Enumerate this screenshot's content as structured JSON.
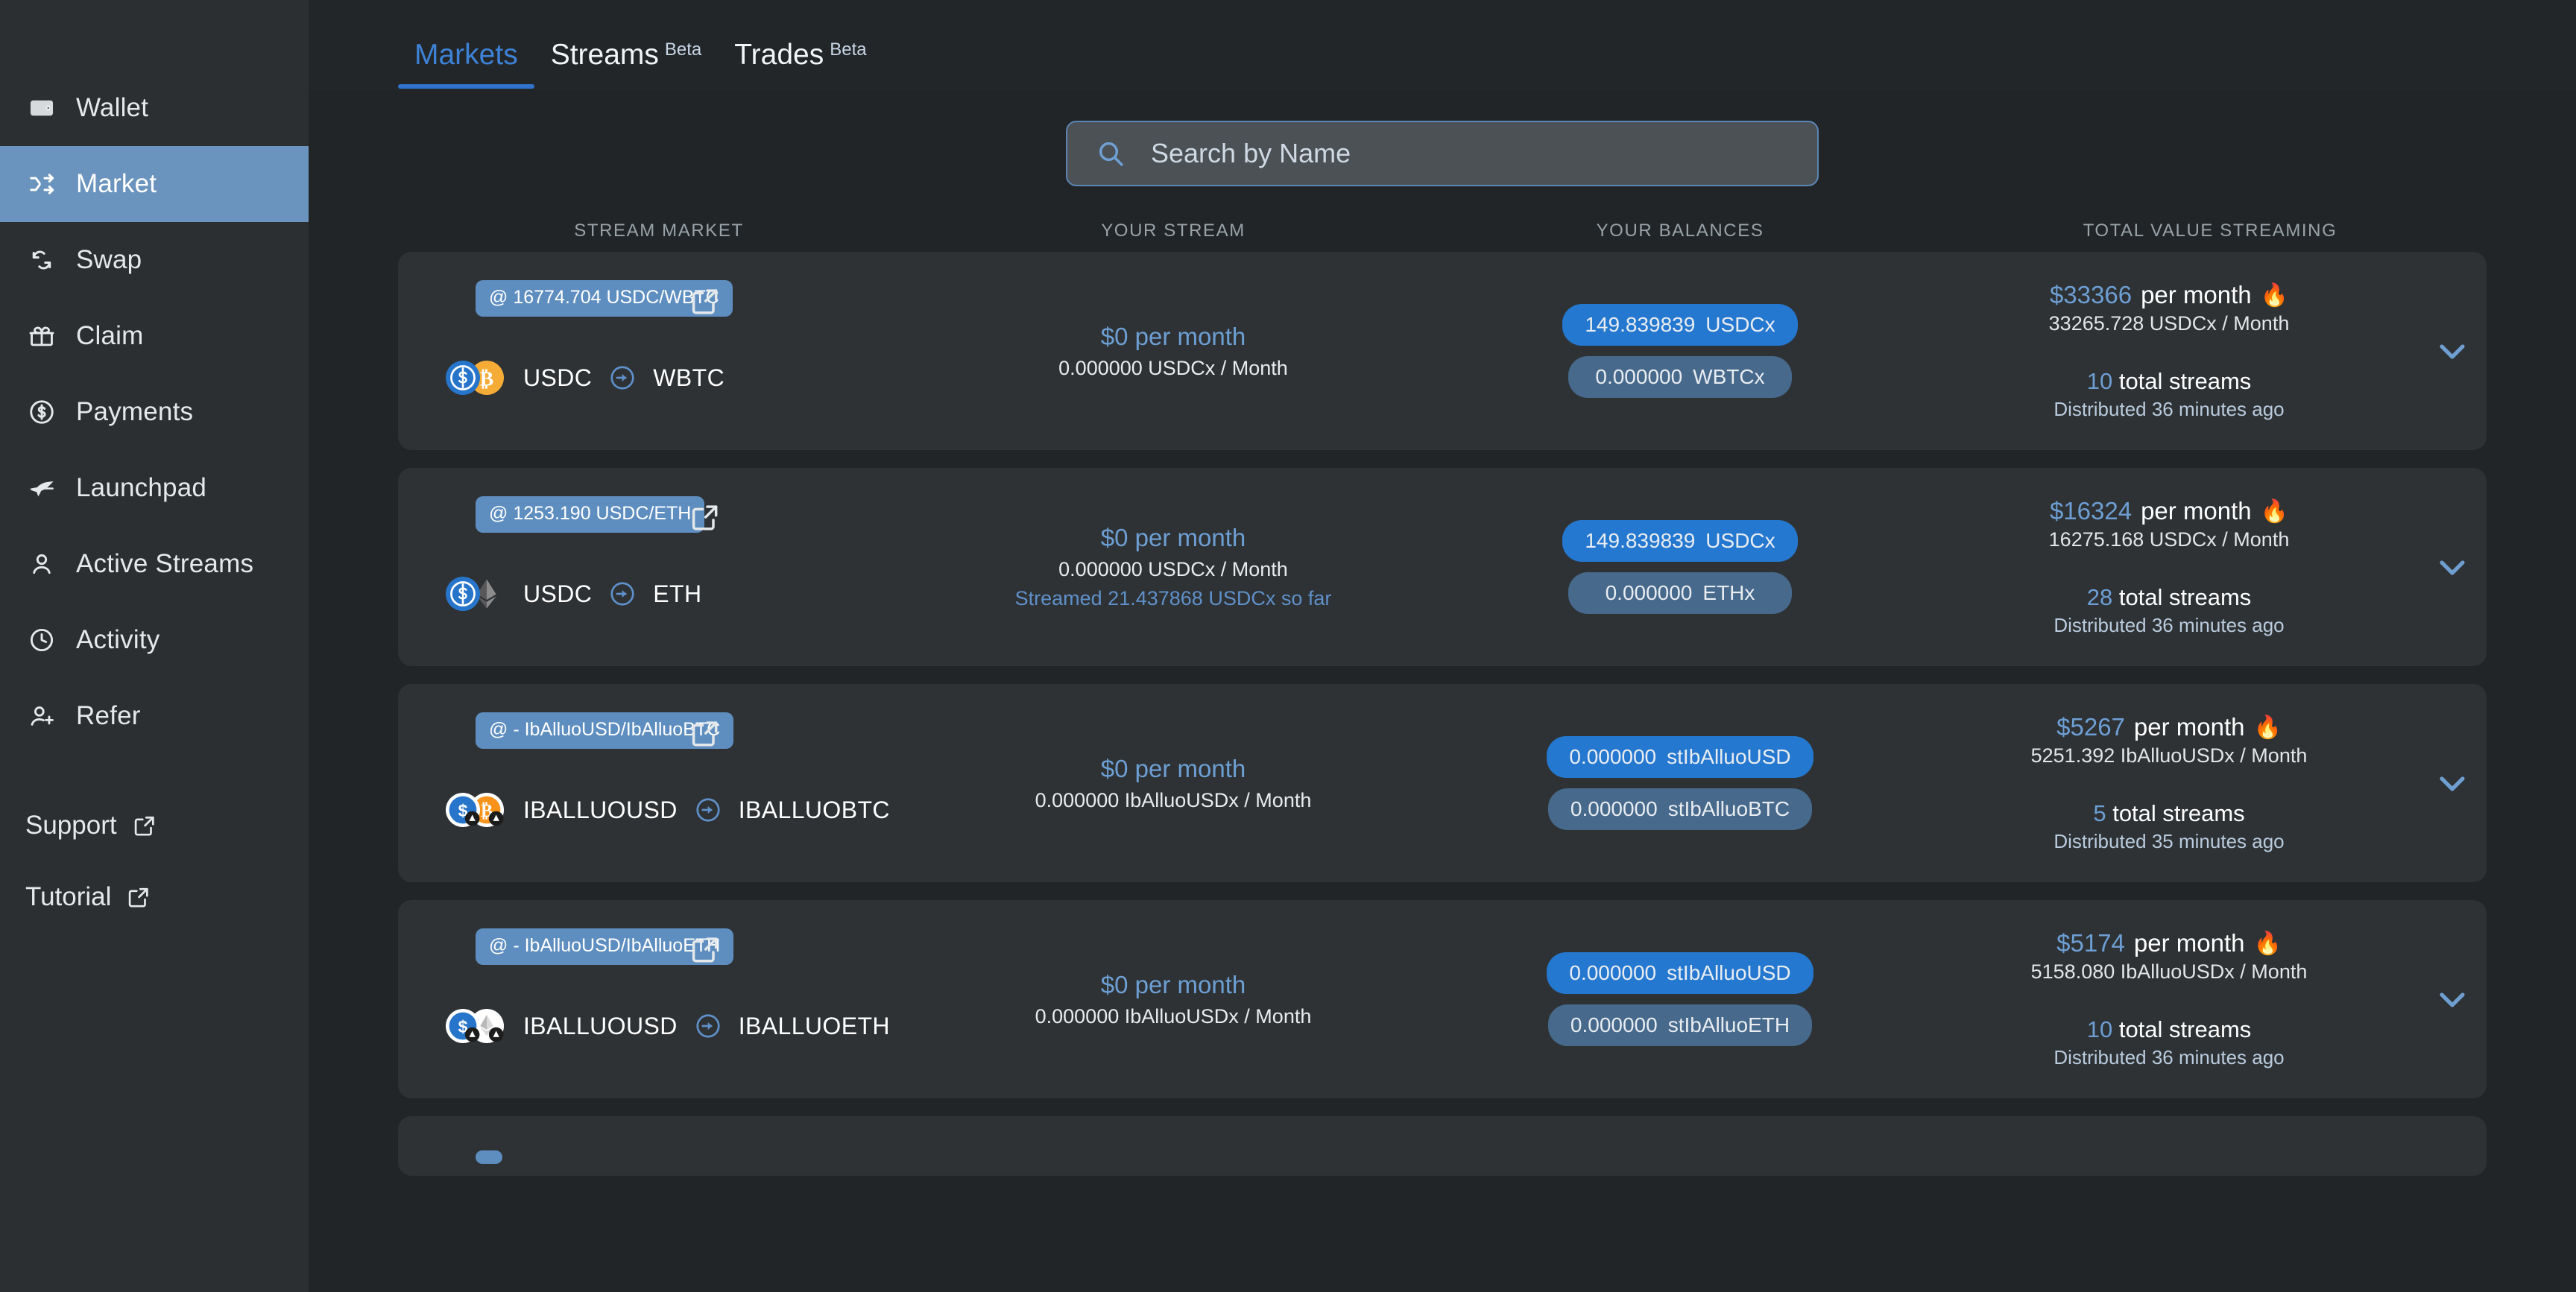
{
  "sidebar": {
    "items": [
      {
        "label": "Wallet",
        "icon": "wallet-icon",
        "active": false
      },
      {
        "label": "Market",
        "icon": "shuffle-icon",
        "active": true
      },
      {
        "label": "Swap",
        "icon": "swap-icon",
        "active": false
      },
      {
        "label": "Claim",
        "icon": "gift-icon",
        "active": false
      },
      {
        "label": "Payments",
        "icon": "dollar-circle-icon",
        "active": false
      },
      {
        "label": "Launchpad",
        "icon": "rocket-icon",
        "active": false
      },
      {
        "label": "Active Streams",
        "icon": "user-icon",
        "active": false
      },
      {
        "label": "Activity",
        "icon": "clock-icon",
        "active": false
      },
      {
        "label": "Refer",
        "icon": "user-plus-icon",
        "active": false
      }
    ],
    "links": [
      {
        "label": "Support",
        "icon": "external-link-icon"
      },
      {
        "label": "Tutorial",
        "icon": "external-link-icon"
      }
    ]
  },
  "tabs": [
    {
      "label": "Markets",
      "badge": "",
      "active": true
    },
    {
      "label": "Streams",
      "badge": "Beta",
      "active": false
    },
    {
      "label": "Trades",
      "badge": "Beta",
      "active": false
    }
  ],
  "search": {
    "placeholder": "Search by Name",
    "value": "",
    "icon": "search-icon"
  },
  "columns": [
    "STREAM MARKET",
    "YOUR STREAM",
    "YOUR BALANCES",
    "TOTAL VALUE STREAMING"
  ],
  "colors": {
    "accent_blue": "#3d82d6",
    "pill_strong": "#2578d0",
    "pill_muted": "#46698c",
    "badge_blue": "#5e8ec0",
    "sidebar_active": "#6a93bd",
    "card_bg": "#2e3235",
    "page_bg": "#212528"
  },
  "rows": [
    {
      "rate": "@ 16774.704 USDC/WBTC",
      "from_token": "USDC",
      "to_token": "WBTC",
      "from_coin": "usdc",
      "to_coin": "wbtc",
      "stream_value": "$0 per month",
      "stream_rate": "0.000000 USDCx / Month",
      "streamed_so_far": "",
      "balances": [
        {
          "amount": "149.839839",
          "symbol": "USDCx",
          "strong": true
        },
        {
          "amount": "0.000000",
          "symbol": "WBTCx",
          "strong": false
        }
      ],
      "total_value": "$33366",
      "total_value_suffix": "per month",
      "flame": "🔥",
      "total_rate": "33265.728 USDCx / Month",
      "stream_count": "10",
      "stream_count_label": "total streams",
      "distributed": "Distributed 36 minutes ago"
    },
    {
      "rate": "@ 1253.190 USDC/ETH",
      "from_token": "USDC",
      "to_token": "ETH",
      "from_coin": "usdc",
      "to_coin": "eth",
      "stream_value": "$0 per month",
      "stream_rate": "0.000000 USDCx / Month",
      "streamed_so_far": "Streamed 21.437868 USDCx so far",
      "balances": [
        {
          "amount": "149.839839",
          "symbol": "USDCx",
          "strong": true
        },
        {
          "amount": "0.000000",
          "symbol": "ETHx",
          "strong": false
        }
      ],
      "total_value": "$16324",
      "total_value_suffix": "per month",
      "flame": "🔥",
      "total_rate": "16275.168 USDCx / Month",
      "stream_count": "28",
      "stream_count_label": "total streams",
      "distributed": "Distributed 36 minutes ago"
    },
    {
      "rate": "@ - IbAlluoUSD/IbAlluoBTC",
      "from_token": "IBALLUOUSD",
      "to_token": "IBALLUOBTC",
      "from_coin": "ibusd",
      "to_coin": "ibbtc",
      "stream_value": "$0 per month",
      "stream_rate": "0.000000 IbAlluoUSDx / Month",
      "streamed_so_far": "",
      "balances": [
        {
          "amount": "0.000000",
          "symbol": "stIbAlluoUSD",
          "strong": true
        },
        {
          "amount": "0.000000",
          "symbol": "stIbAlluoBTC",
          "strong": false
        }
      ],
      "total_value": "$5267",
      "total_value_suffix": "per month",
      "flame": "🔥",
      "total_rate": "5251.392 IbAlluoUSDx / Month",
      "stream_count": "5",
      "stream_count_label": "total streams",
      "distributed": "Distributed 35 minutes ago"
    },
    {
      "rate": "@ - IbAlluoUSD/IbAlluoETH",
      "from_token": "IBALLUOUSD",
      "to_token": "IBALLUOETH",
      "from_coin": "ibusd",
      "to_coin": "ibeth",
      "stream_value": "$0 per month",
      "stream_rate": "0.000000 IbAlluoUSDx / Month",
      "streamed_so_far": "",
      "balances": [
        {
          "amount": "0.000000",
          "symbol": "stIbAlluoUSD",
          "strong": true
        },
        {
          "amount": "0.000000",
          "symbol": "stIbAlluoETH",
          "strong": false
        }
      ],
      "total_value": "$5174",
      "total_value_suffix": "per month",
      "flame": "🔥",
      "total_rate": "5158.080 IbAlluoUSDx / Month",
      "stream_count": "10",
      "stream_count_label": "total streams",
      "distributed": "Distributed 36 minutes ago"
    }
  ],
  "partial_row": {
    "rate": ""
  }
}
